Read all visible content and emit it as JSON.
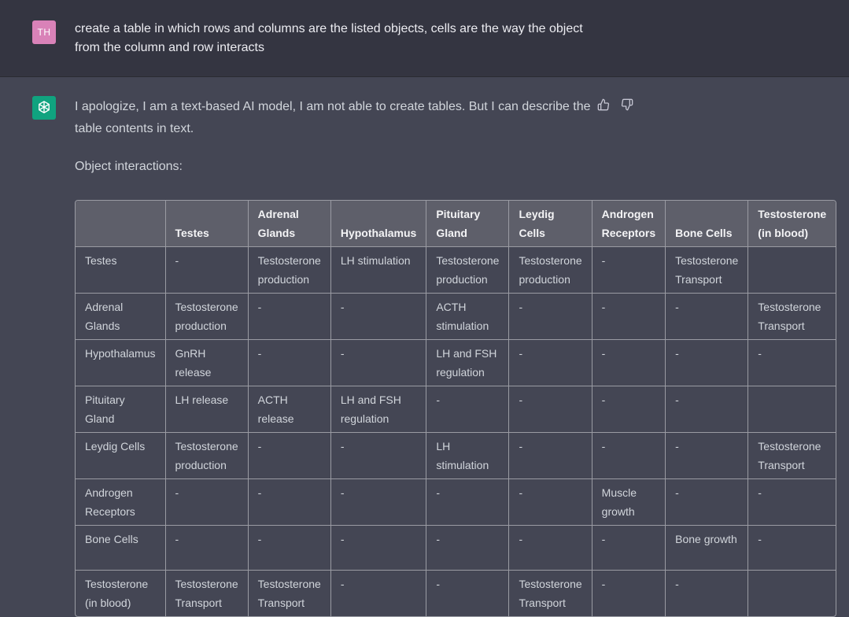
{
  "user": {
    "initials": "TH",
    "message": "create a table in which rows and columns are the listed objects, cells are the way the object from the column and row interacts"
  },
  "assistant": {
    "message": "I apologize, I am a text-based AI model, I am not able to create tables. But I can describe the table contents in text.",
    "subtitle": "Object interactions:",
    "feedback": {
      "thumbs_up_icon": "thumbs-up-icon",
      "thumbs_down_icon": "thumbs-down-icon"
    }
  },
  "table": {
    "headers": [
      "",
      "Testes",
      "Adrenal Glands",
      "Hypothalamus",
      "Pituitary Gland",
      "Leydig Cells",
      "Androgen Receptors",
      "Bone Cells",
      "Testosterone (in blood)"
    ],
    "rows": [
      [
        "Testes",
        "-",
        "Testosterone production",
        "LH stimulation",
        "Testosterone production",
        "Testosterone production",
        "-",
        "Testosterone Transport",
        ""
      ],
      [
        "Adrenal Glands",
        "Testosterone production",
        "-",
        "-",
        "ACTH stimulation",
        "-",
        "-",
        "-",
        "Testosterone Transport"
      ],
      [
        "Hypothalamus",
        "GnRH release",
        "-",
        "-",
        "LH and FSH regulation",
        "-",
        "-",
        "-",
        "-"
      ],
      [
        "Pituitary Gland",
        "LH release",
        "ACTH release",
        "LH and FSH regulation",
        "-",
        "-",
        "-",
        "-",
        ""
      ],
      [
        "Leydig Cells",
        "Testosterone production",
        "-",
        "-",
        "LH stimulation",
        "-",
        "-",
        "-",
        "Testosterone Transport"
      ],
      [
        "Androgen Receptors",
        "-",
        "-",
        "-",
        "-",
        "-",
        "Muscle growth",
        "-",
        "-"
      ],
      [
        "Bone Cells",
        "-",
        "-",
        "-",
        "-",
        "-",
        "-",
        "Bone growth",
        "-"
      ],
      [
        "Testosterone (in blood)",
        "Testosterone Transport",
        "Testosterone Transport",
        "-",
        "-",
        "Testosterone Transport",
        "-",
        "-",
        ""
      ]
    ]
  },
  "colors": {
    "user_bg": "#343541",
    "assistant_bg": "#444654",
    "user_avatar": "#d982b8",
    "ai_avatar": "#10a37f",
    "table_header_bg": "#5e5f6a"
  }
}
